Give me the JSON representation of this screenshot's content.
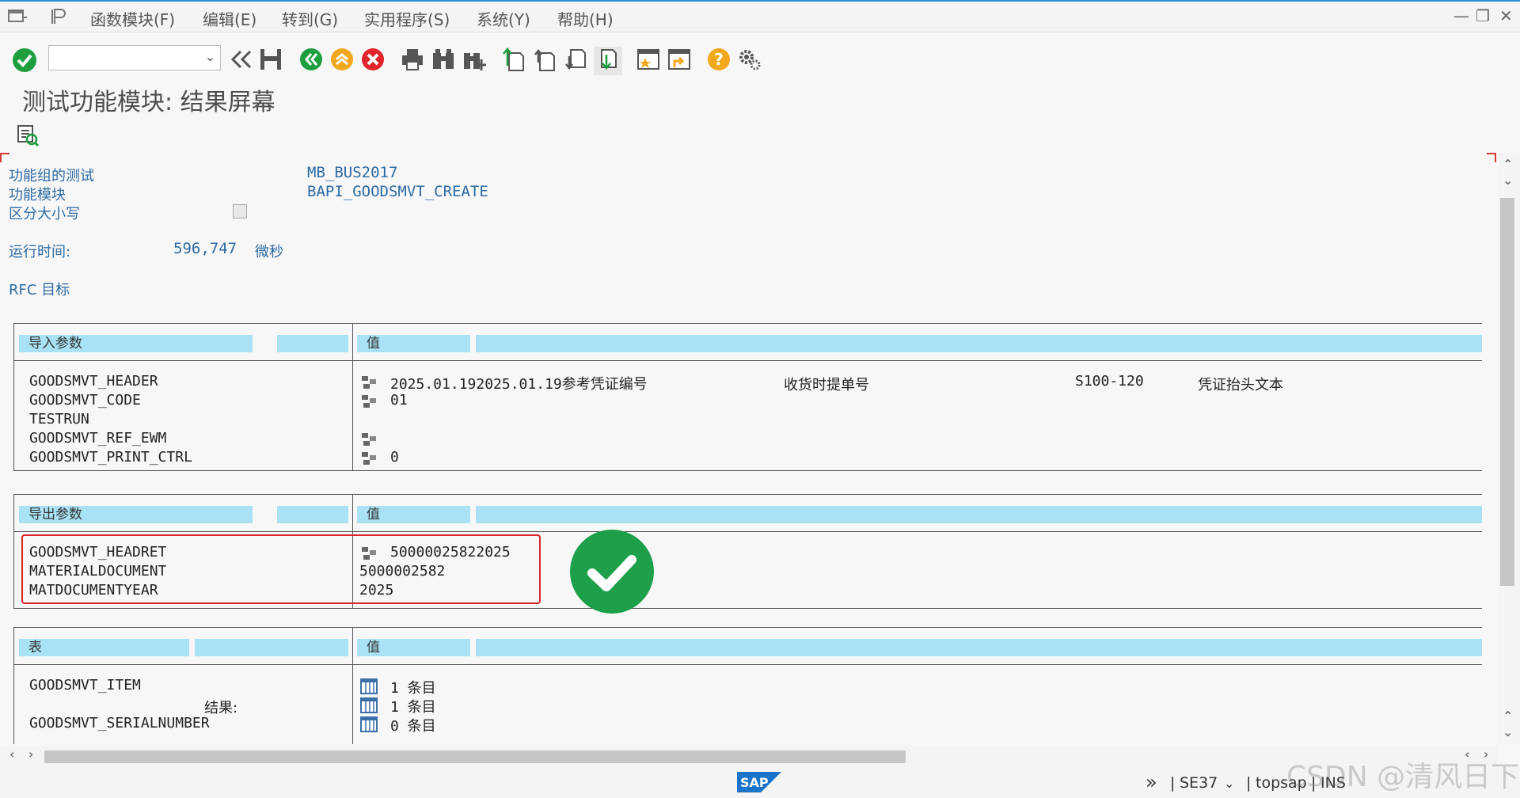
{
  "menu": {
    "items": [
      {
        "label": "函数模块(F)"
      },
      {
        "label": "编辑(E)"
      },
      {
        "label": "转到(G)"
      },
      {
        "label": "实用程序(S)"
      },
      {
        "label": "系统(Y)"
      },
      {
        "label": "帮助(H)"
      }
    ]
  },
  "toolbar": {
    "command_field_value": "",
    "icons": [
      "enter-check-icon",
      "back-double-icon",
      "save-icon",
      "back-icon",
      "exit-icon",
      "cancel-icon",
      "print-icon",
      "find-icon",
      "find-next-icon",
      "first-page-icon",
      "previous-page-icon",
      "next-page-icon",
      "last-page-icon",
      "create-session-icon",
      "shortcut-icon",
      "help-icon",
      "customize-gear-icon"
    ]
  },
  "page": {
    "title": "测试功能模块: 结果屏幕"
  },
  "info": {
    "function_group_label": "功能组的测试",
    "function_group_value": "MB_BUS2017",
    "function_module_label": "功能模块",
    "function_module_value": "BAPI_GOODSMVT_CREATE",
    "case_sensitive_label": "区分大小写",
    "runtime_label": "运行时间:",
    "runtime_value": "596,747",
    "runtime_unit": "微秒",
    "rfc_label": "RFC 目标"
  },
  "import": {
    "header": "导入参数",
    "value_header": "值",
    "rows": [
      {
        "name": "GOODSMVT_HEADER",
        "value": "2025.01.192025.01.19参考凭证编号",
        "extra1": "收货时提单号",
        "extra2": "S100-120",
        "extra3": "凭证抬头文本"
      },
      {
        "name": "GOODSMVT_CODE",
        "value": "01"
      },
      {
        "name": "TESTRUN",
        "value": ""
      },
      {
        "name": "GOODSMVT_REF_EWM",
        "value": ""
      },
      {
        "name": "GOODSMVT_PRINT_CTRL",
        "value": "0"
      }
    ]
  },
  "export": {
    "header": "导出参数",
    "value_header": "值",
    "rows": [
      {
        "name": "GOODSMVT_HEADRET",
        "value": "50000025822025"
      },
      {
        "name": "MATERIALDOCUMENT",
        "value": "5000002582"
      },
      {
        "name": "MATDOCUMENTYEAR",
        "value": "2025"
      }
    ]
  },
  "tables": {
    "header": "表",
    "value_header": "值",
    "rows": [
      {
        "name": "GOODSMVT_ITEM",
        "value": "1 条目"
      },
      {
        "name": "结果:",
        "value": "1 条目"
      },
      {
        "name": "GOODSMVT_SERIALNUMBER",
        "value": "0 条目"
      }
    ]
  },
  "status": {
    "transaction": "SE37",
    "server": "topsap",
    "mode": "INS",
    "brand": "SAP"
  },
  "colors": {
    "label_blue": "#2d6aa3",
    "header_cyan": "#a8e2f4",
    "highlight_red": "#d9262c",
    "success_green": "#1ea04a"
  }
}
